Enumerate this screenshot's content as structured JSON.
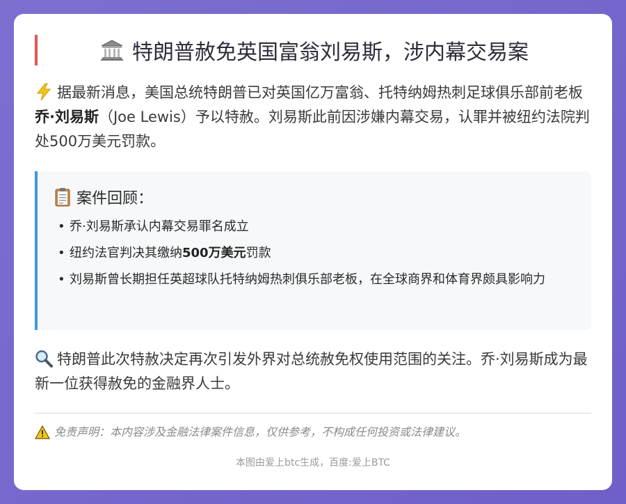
{
  "title": {
    "text": "特朗普赦免英国富翁刘易斯，涉内幕交易案",
    "icon": "bank-building-icon"
  },
  "intro": {
    "icon": "lightning-icon",
    "before": "据最新消息，美国总统特朗普已对英国亿万富翁、托特纳姆热刺足球俱乐部前老板",
    "name": "乔·刘易斯",
    "after": "（Joe Lewis）予以特赦。刘易斯此前因涉嫌内幕交易，认罪并被纽约法院判处500万美元罚款。"
  },
  "review": {
    "icon": "clipboard-icon",
    "heading": "案件回顾：",
    "items": [
      {
        "text": "乔·刘易斯承认内幕交易罪名成立"
      },
      {
        "before": "纽约法官判决其缴纳",
        "bold": "500万美元",
        "after": "罚款"
      },
      {
        "text": "刘易斯曾长期担任英超球队托特纳姆热刺俱乐部老板，在全球商界和体育界颇具影响力"
      }
    ],
    "bullet": "•"
  },
  "analysis": {
    "icon": "magnifier-icon",
    "text": "特朗普此次特赦决定再次引发外界对总统赦免权使用范围的关注。乔·刘易斯成为最新一位获得赦免的金融界人士。"
  },
  "disclaimer": {
    "icon": "warning-icon",
    "text": "免责声明：本内容涉及金融法律案件信息，仅供参考，不构成任何投资或法律建议。"
  },
  "footer": {
    "text": "本图由爱上btc生成，百度:爱上BTC"
  },
  "colors": {
    "background": "#7b6fd0",
    "title_accent": "#e2564e",
    "review_accent": "#3c9ae0",
    "review_bg": "#f6f8fa"
  }
}
